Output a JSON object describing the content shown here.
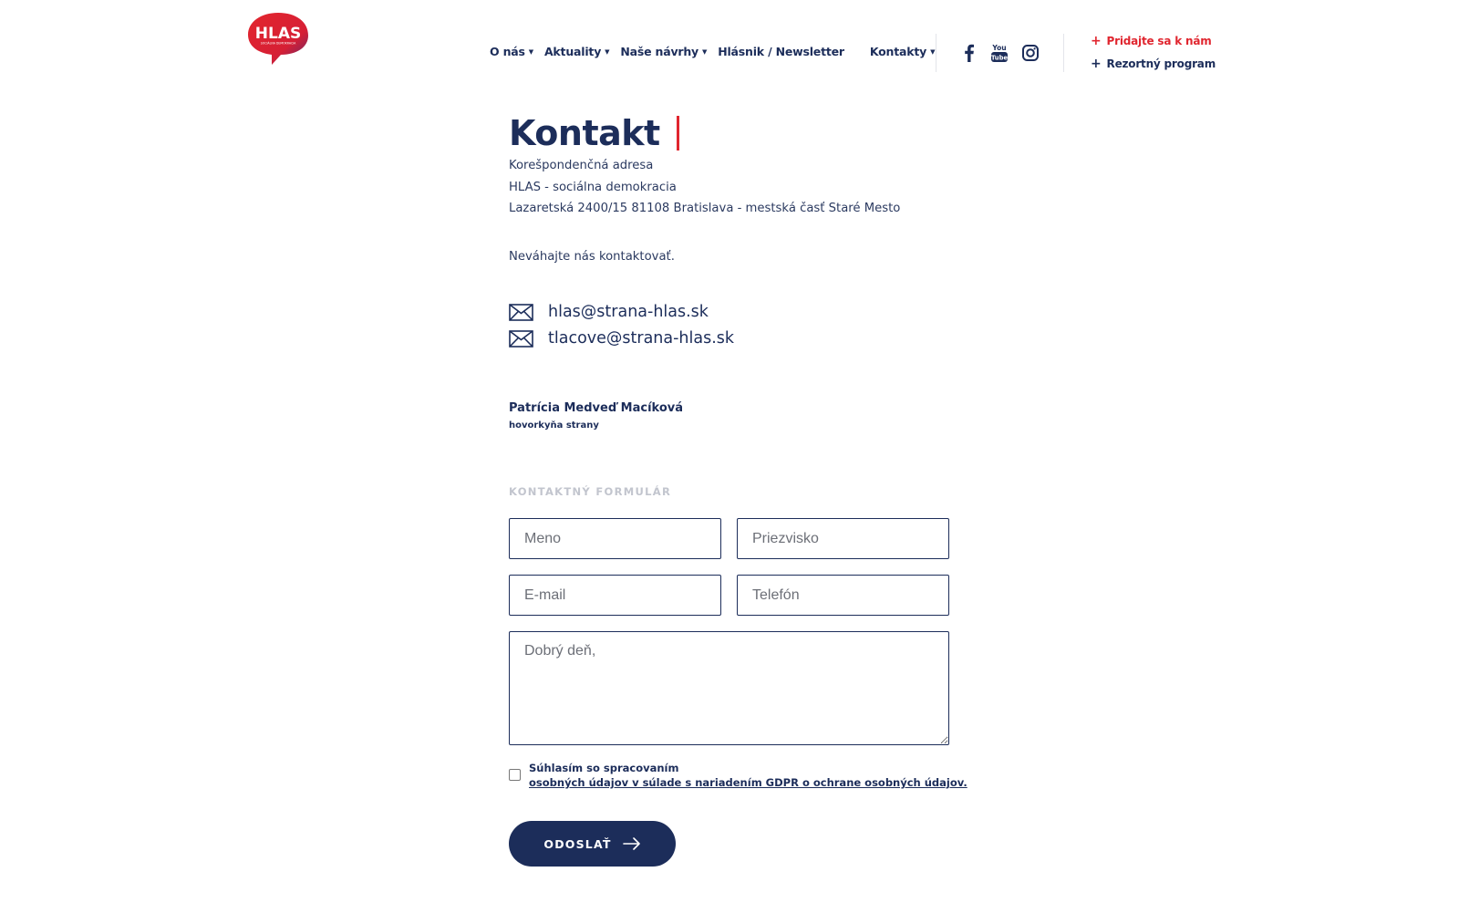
{
  "logo": {
    "text": "HLAS",
    "subtext": "SOCIÁLNA DEMOKRACIA",
    "color": "#e0262f"
  },
  "nav": {
    "items": [
      {
        "label": "O nás",
        "has_dropdown": true
      },
      {
        "label": "Aktuality",
        "has_dropdown": true
      },
      {
        "label": "Naše návrhy",
        "has_dropdown": true
      },
      {
        "label": "Hlásnik / Newsletter",
        "has_dropdown": false
      },
      {
        "label": "Kontakty",
        "has_dropdown": true
      }
    ],
    "social": [
      "facebook-icon",
      "youtube-icon",
      "instagram-icon"
    ],
    "cta_join": "Pridajte sa k nám",
    "cta_program": "Rezortný program"
  },
  "page": {
    "title": "Kontakt",
    "address_lines": [
      "Korešpondenčná adresa",
      "HLAS - sociálna demokracia",
      "Lazaretská 2400/15 81108 Bratislava - mestská časť Staré Mesto"
    ],
    "contact_prompt": "Neváhajte nás kontaktovať.",
    "emails": [
      "hlas@strana-hlas.sk",
      "tlacove@strana-hlas.sk"
    ],
    "spokesperson": {
      "name": "Patrícia Medveď Macíková",
      "role": "hovorkyňa strany"
    }
  },
  "form": {
    "label": "KONTAKTNÝ FORMULÁR",
    "first_name_placeholder": "Meno",
    "last_name_placeholder": "Priezvisko",
    "email_placeholder": "E-mail",
    "phone_placeholder": "Telefón",
    "message_placeholder": "Dobrý deň,",
    "consent_line1": "Súhlasím so spracovaním",
    "consent_link": "osobných údajov v súlade s nariadením GDPR o ochrane osobných údajov.",
    "submit_label": "ODOSLAŤ"
  },
  "colors": {
    "navy": "#1c2d5a",
    "red": "#e0262f",
    "muted": "#c2c5ce"
  }
}
